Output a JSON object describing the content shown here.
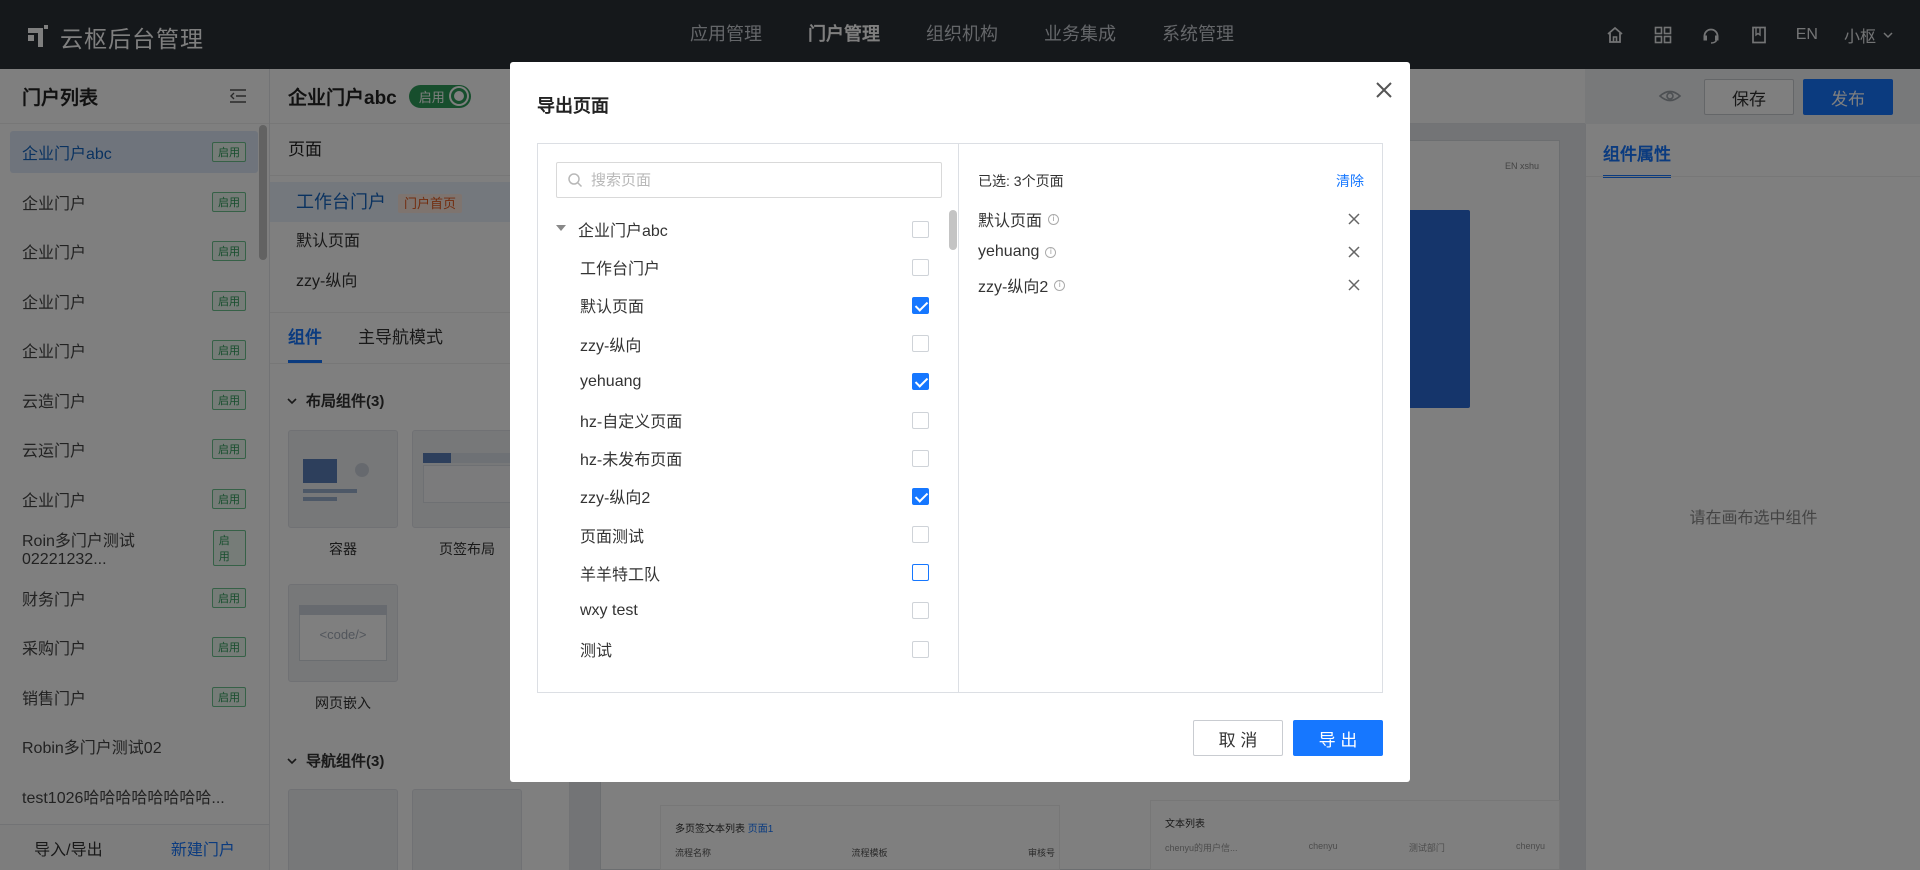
{
  "app": {
    "title": "云枢后台管理"
  },
  "topnav": {
    "items": [
      "应用管理",
      "门户管理",
      "组织机构",
      "业务集成",
      "系统管理"
    ],
    "active_index": 1
  },
  "topright": {
    "icons": [
      "home-icon",
      "apps-grid-icon",
      "headset-icon",
      "book-icon"
    ],
    "lang": "EN",
    "user": "小枢"
  },
  "portal_list": {
    "title": "门户列表",
    "items": [
      {
        "label": "企业门户abc",
        "badge": "启用",
        "active": true
      },
      {
        "label": "企业门户",
        "badge": "启用"
      },
      {
        "label": "企业门户",
        "badge": "启用"
      },
      {
        "label": "企业门户",
        "badge": "启用"
      },
      {
        "label": "企业门户",
        "badge": "启用"
      },
      {
        "label": "云造门户",
        "badge": "启用"
      },
      {
        "label": "云运门户",
        "badge": "启用"
      },
      {
        "label": "企业门户",
        "badge": "启用"
      },
      {
        "label": "Roin多门户测试02221232...",
        "badge": "启用"
      },
      {
        "label": "财务门户",
        "badge": "启用"
      },
      {
        "label": "采购门户",
        "badge": "启用"
      },
      {
        "label": "销售门户",
        "badge": "启用"
      },
      {
        "label": "Robin多门户测试02",
        "badge": ""
      },
      {
        "label": "test1026哈哈哈哈哈哈哈哈...",
        "badge": ""
      }
    ],
    "footer": {
      "import_export": "导入/导出",
      "new_portal": "新建门户"
    }
  },
  "editor": {
    "portal_name": "企业门户abc",
    "status_label": "启用",
    "pages_title": "页面",
    "pages": [
      {
        "label": "工作台门户",
        "tag": "门户首页"
      },
      {
        "label": "默认页面"
      },
      {
        "label": "zzy-纵向"
      }
    ],
    "tabs": [
      "组件",
      "主导航模式"
    ],
    "sections": {
      "layout": "布局组件(3)",
      "nav": "导航组件(3)"
    },
    "components": [
      "容器",
      "页签布局",
      "网页嵌入"
    ],
    "code_placeholder": "<code/>",
    "save": "保存",
    "publish": "发布",
    "canvas": {
      "header_text": "EN xshu",
      "card1_title": "多页签文本列表",
      "card1_tab": "页面1",
      "card1_cols": [
        "流程名称",
        "流程模板",
        "审核号"
      ],
      "card2_title": "文本列表",
      "card2_cols": [
        "chenyu的用户信...",
        "chenyu",
        "测试部门",
        "chenyu"
      ]
    }
  },
  "properties": {
    "tab": "组件属性",
    "empty": "请在画布选中组件"
  },
  "modal": {
    "title": "导出页面",
    "search_placeholder": "搜索页面",
    "tree": {
      "root": "企业门户abc",
      "items": [
        {
          "label": "工作台门户",
          "checked": false
        },
        {
          "label": "默认页面",
          "checked": true
        },
        {
          "label": "zzy-纵向",
          "checked": false
        },
        {
          "label": "yehuang",
          "checked": true
        },
        {
          "label": "hz-自定义页面",
          "checked": false
        },
        {
          "label": "hz-未发布页面",
          "checked": false
        },
        {
          "label": "zzy-纵向2",
          "checked": true
        },
        {
          "label": "页面测试",
          "checked": false
        },
        {
          "label": "羊羊特工队",
          "checked": false,
          "focus": true
        },
        {
          "label": "wxy test",
          "checked": false
        },
        {
          "label": "测试",
          "checked": false
        }
      ]
    },
    "selected": {
      "summary": "已选: 3个页面",
      "clear": "清除",
      "items": [
        "默认页面",
        "yehuang",
        "zzy-纵向2"
      ]
    },
    "cancel": "取 消",
    "export": "导 出"
  },
  "colors": {
    "topbar": "#2b3036",
    "primary": "#1677ff",
    "enabled_green": "#2e9c5a",
    "home_tag": "#e45a1f"
  }
}
